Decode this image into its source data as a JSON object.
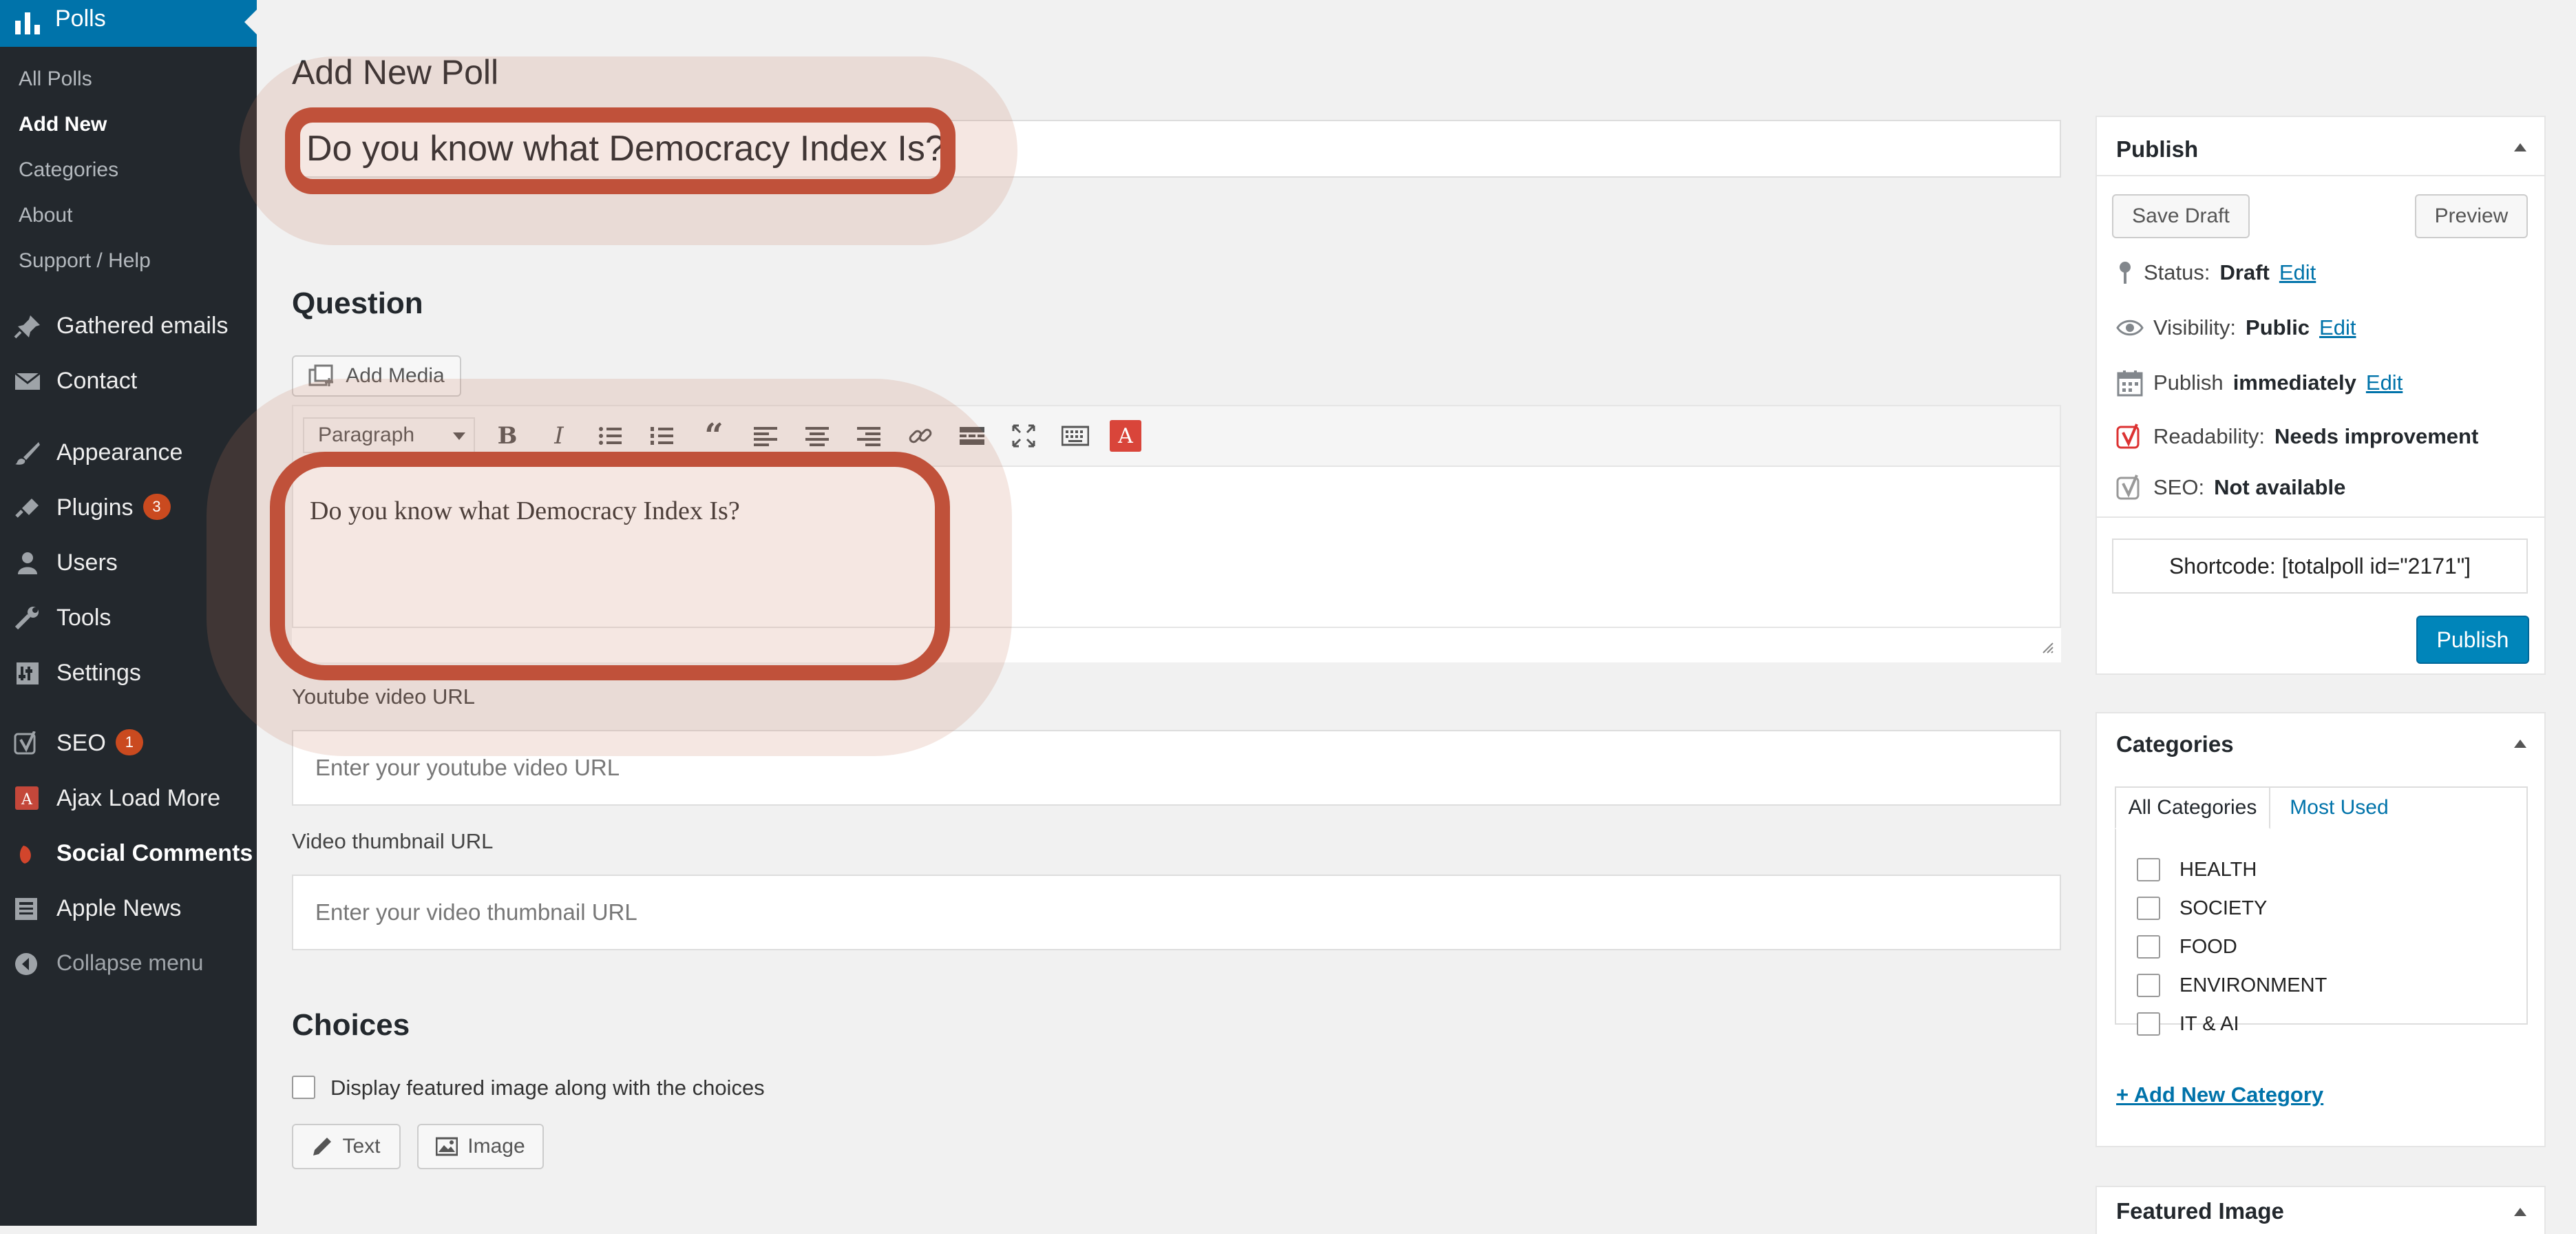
{
  "sidebar": {
    "header": {
      "label": "Polls"
    },
    "submenu": [
      {
        "label": "All Polls"
      },
      {
        "label": "Add New"
      },
      {
        "label": "Categories"
      },
      {
        "label": "About"
      },
      {
        "label": "Support / Help"
      }
    ],
    "items": [
      {
        "label": "Gathered emails",
        "icon": "pin-icon"
      },
      {
        "label": "Contact",
        "icon": "mail-icon"
      },
      {
        "label": "Appearance",
        "icon": "brush-icon"
      },
      {
        "label": "Plugins",
        "icon": "plugin-icon",
        "badge": "3"
      },
      {
        "label": "Users",
        "icon": "user-icon"
      },
      {
        "label": "Tools",
        "icon": "wrench-icon"
      },
      {
        "label": "Settings",
        "icon": "settings-icon"
      },
      {
        "label": "SEO",
        "icon": "yoast-icon",
        "badge": "1"
      },
      {
        "label": "Ajax Load More",
        "icon": "ajax-load-more-icon"
      },
      {
        "label": "Social Comments",
        "icon": "social-comments-icon"
      },
      {
        "label": "Apple News",
        "icon": "news-icon"
      }
    ],
    "collapse": {
      "label": "Collapse menu"
    }
  },
  "main": {
    "page_title": "Add New Poll",
    "title_value": "Do you know what Democracy Index Is?",
    "question_heading": "Question",
    "add_media_label": "Add Media",
    "editor": {
      "format": "Paragraph",
      "content": "Do you know what Democracy Index Is?"
    },
    "youtube": {
      "label": "Youtube video URL",
      "placeholder": "Enter your youtube video URL"
    },
    "thumbnail": {
      "label": "Video thumbnail URL",
      "placeholder": "Enter your video thumbnail URL"
    },
    "choices_heading": "Choices",
    "featured_choice_label": "Display featured image along with the choices",
    "text_button": "Text",
    "image_button": "Image"
  },
  "publish_panel": {
    "title": "Publish",
    "save_draft": "Save Draft",
    "preview": "Preview",
    "status_label": "Status:",
    "status_value": "Draft",
    "visibility_label": "Visibility:",
    "visibility_value": "Public",
    "publish_label": "Publish",
    "publish_value": "immediately",
    "edit_link": "Edit",
    "readability_label": "Readability:",
    "readability_value": "Needs improvement",
    "seo_label": "SEO:",
    "seo_value": "Not available",
    "shortcode": "Shortcode: [totalpoll id=\"2171\"]",
    "publish_button": "Publish"
  },
  "categories_panel": {
    "title": "Categories",
    "tab_all": "All Categories",
    "tab_used": "Most Used",
    "items": [
      "HEALTH",
      "SOCIETY",
      "FOOD",
      "ENVIRONMENT",
      "IT & AI"
    ],
    "add_new": "+ Add New Category"
  },
  "featured_image_panel": {
    "title": "Featured Image"
  },
  "colors": {
    "accent": "#0073aa",
    "sidebar": "#23282d",
    "highlight": "#c0513a",
    "button_primary": "#0085ba"
  }
}
